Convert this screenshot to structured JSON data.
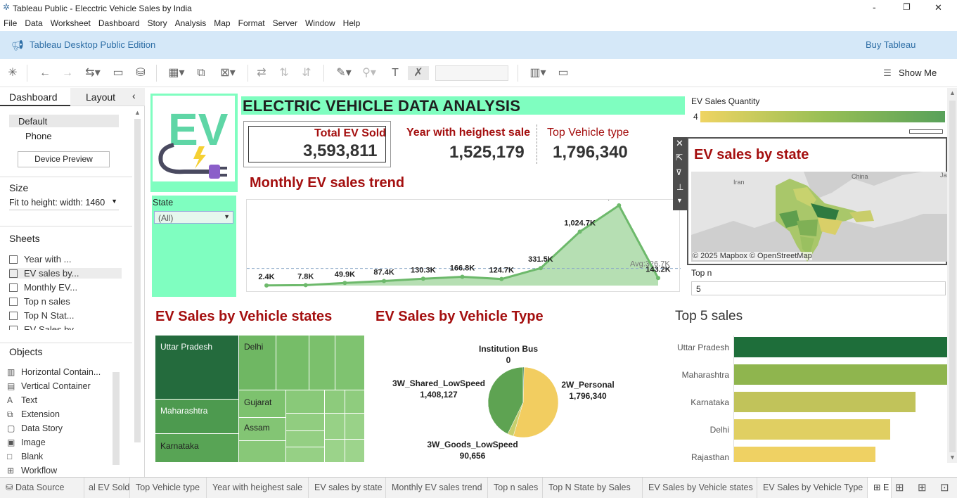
{
  "window": {
    "title": "Tableau Public - Elecctric Vehicle Sales by India",
    "min": "-",
    "max": "❐",
    "close": "✕"
  },
  "menu": [
    "File",
    "Data",
    "Worksheet",
    "Dashboard",
    "Story",
    "Analysis",
    "Map",
    "Format",
    "Server",
    "Window",
    "Help"
  ],
  "edition": {
    "label": "Tableau Desktop Public Edition",
    "buy": "Buy Tableau"
  },
  "toolbar": {
    "show_me": "Show Me"
  },
  "left": {
    "tab_dashboard": "Dashboard",
    "tab_layout": "Layout",
    "device_default": "Default",
    "device_phone": "Phone",
    "device_preview": "Device Preview",
    "size_title": "Size",
    "size_value": "Fit to height: width: 1460",
    "sheets_title": "Sheets",
    "sheets": [
      "Year with ...",
      "EV sales by...",
      "Monthly EV...",
      "Top n sales",
      "Top  N Stat...",
      "EV Sales by..."
    ],
    "objects_title": "Objects",
    "objects": [
      "Horizontal Contain...",
      "Vertical Container",
      "Text",
      "Extension",
      "Data Story",
      "Image",
      "Blank",
      "Workflow"
    ],
    "object_icons": [
      "▥",
      "▤",
      "A",
      "⧉",
      "▢",
      "▣",
      "□",
      "⊞"
    ]
  },
  "dashboard": {
    "logo_text": "EV",
    "title": "ELECTRIC VEHICLE DATA ANALYSIS",
    "kpi1_label": "Total EV Sold",
    "kpi1_value": "3,593,811",
    "kpi2_label": "Year with heighest sale",
    "kpi2_value": "1,525,179",
    "kpi3_label": "Top Vehicle type",
    "kpi3_value": "1,796,340",
    "filter_label": "State",
    "filter_value": "(All)",
    "legend_label": "EV Sales Quantity",
    "legend_min": "4",
    "map_title": "EV sales by state",
    "map_credit": "© 2025 Mapbox © OpenStreetMap",
    "map_labels": [
      "Iran",
      "China",
      "Ja"
    ],
    "topn_label": "Top n",
    "topn_value": "5",
    "trend_title": "Monthly EV sales trend",
    "treemap_title": "EV Sales by Vehicle states",
    "pie_title": "EV Sales by Vehicle Type",
    "bar_title": "Top 5 sales"
  },
  "tabs": [
    "Data Source",
    "al EV Sold",
    "Top Vehicle type",
    "Year with heighest sale",
    "EV sales by state",
    "Monthly EV sales trend",
    "Top n sales",
    "Top  N State by Sales",
    "EV Sales by Vehicle states",
    "EV Sales by Vehicle Type",
    "E"
  ],
  "chart_data": [
    {
      "type": "area",
      "title": "Monthly EV sales trend",
      "values": [
        2.4,
        7.8,
        49.9,
        87.4,
        130.3,
        166.8,
        124.7,
        331.5,
        1024.7,
        1525.2,
        143.2
      ],
      "labels": [
        "2.4K",
        "7.8K",
        "49.9K",
        "87.4K",
        "130.3K",
        "166.8K",
        "124.7K",
        "331.5K",
        "1,024.7K",
        "1,525.2K",
        "143.2K"
      ],
      "reference_line": {
        "label": "Avg:326.7K",
        "value": 326.7
      },
      "color": "#6db96b"
    },
    {
      "type": "heatmap",
      "title": "EV Sales by Vehicle states",
      "categories": [
        "Uttar Pradesh",
        "Maharashtra",
        "Karnataka",
        "Delhi",
        "Gujarat",
        "Assam"
      ]
    },
    {
      "type": "pie",
      "title": "EV Sales by Vehicle Type",
      "slices": [
        {
          "label": "2W_Personal",
          "value": 1796340,
          "value_label": "1,796,340",
          "color": "#f2cd60"
        },
        {
          "label": "3W_Goods_LowSpeed",
          "value": 90656,
          "value_label": "90,656",
          "color": "#c7cf6c"
        },
        {
          "label": "3W_Shared_LowSpeed",
          "value": 1408127,
          "value_label": "1,408,127",
          "color": "#5ea352"
        },
        {
          "label": "Institution Bus",
          "value": 0,
          "value_label": "0",
          "color": "#1d6b3a"
        }
      ]
    },
    {
      "type": "bar",
      "title": "Top 5 sales",
      "categories": [
        "Uttar Pradesh",
        "Maharashtra",
        "Karnataka",
        "Delhi",
        "Rajasthan"
      ],
      "colors": [
        "#1e6e3a",
        "#8fb54e",
        "#c1c35a",
        "#e0cf62",
        "#efd163"
      ],
      "values": [
        100,
        100,
        85,
        73,
        66
      ]
    }
  ]
}
